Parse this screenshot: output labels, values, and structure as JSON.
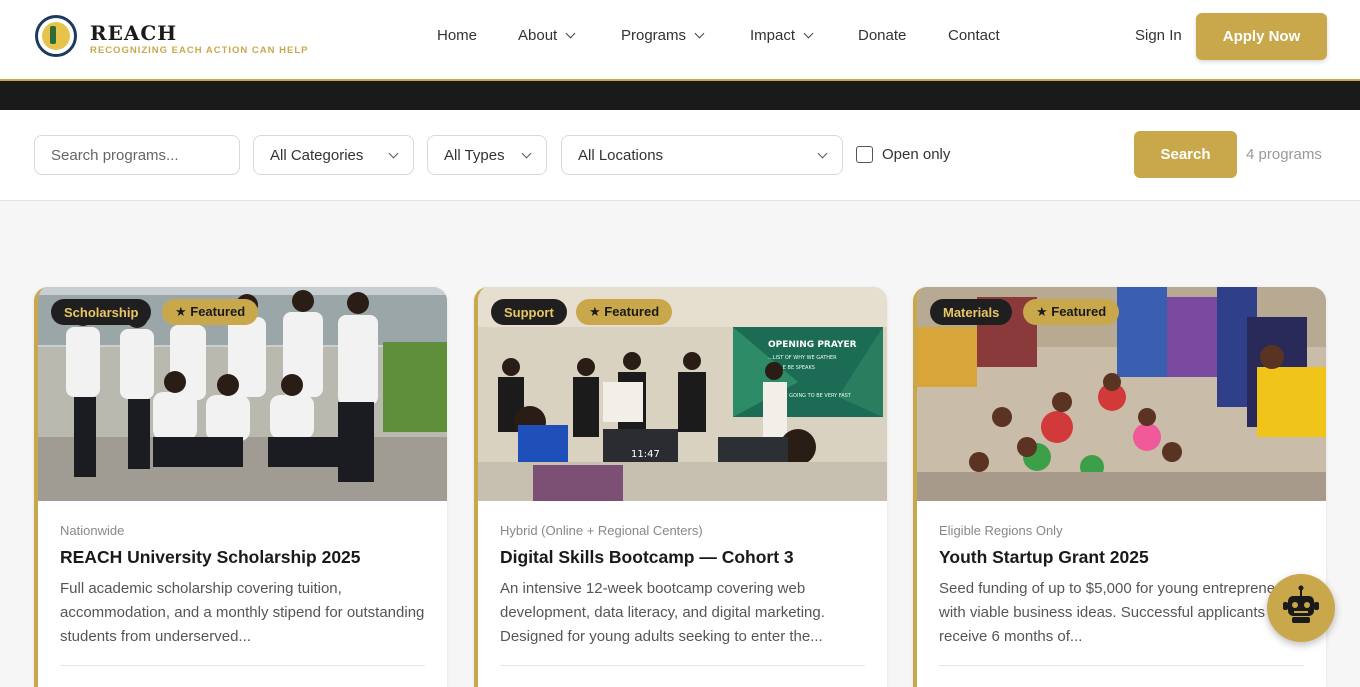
{
  "brand": {
    "name": "REACH",
    "tagline": "RECOGNIZING EACH ACTION CAN HELP"
  },
  "nav": {
    "items": [
      {
        "label": "Home",
        "dropdown": false
      },
      {
        "label": "About",
        "dropdown": true
      },
      {
        "label": "Programs",
        "dropdown": true
      },
      {
        "label": "Impact",
        "dropdown": true
      },
      {
        "label": "Donate",
        "dropdown": false
      },
      {
        "label": "Contact",
        "dropdown": false
      }
    ],
    "sign_in": "Sign In",
    "apply": "Apply Now"
  },
  "filters": {
    "search_placeholder": "Search programs...",
    "category": "All Categories",
    "type": "All Types",
    "location": "All Locations",
    "open_only": "Open only",
    "search_button": "Search",
    "result_count": "4 programs"
  },
  "cards": [
    {
      "category": "Scholarship",
      "featured": "★ Featured",
      "location": "Nationwide",
      "title": "REACH University Scholarship 2025",
      "description": "Full academic scholarship covering tuition, accommodation, and a monthly stipend for outstanding students from underserved..."
    },
    {
      "category": "Support",
      "featured": "★ Featured",
      "location": "Hybrid (Online + Regional Centers)",
      "title": "Digital Skills Bootcamp — Cohort 3",
      "description": "An intensive 12-week bootcamp covering web development, data literacy, and digital marketing. Designed for young adults seeking to enter the...",
      "image_text": {
        "heading": "OPENING PRAYER",
        "lines": [
          "...LIST OF WHY WE GATHER",
          "...E BE SPEAKS"
        ],
        "footer": "...E ARE GOING TO BE VERY FAST",
        "clock": "11:47"
      }
    },
    {
      "category": "Materials",
      "featured": "★ Featured",
      "location": "Eligible Regions Only",
      "title": "Youth Startup Grant 2025",
      "description": "Seed funding of up to $5,000 for young entrepreneurs with viable business ideas. Successful applicants also receive 6 months of..."
    }
  ],
  "colors": {
    "accent": "#c9a84c",
    "dark": "#1a1a1a"
  },
  "chatbot": {
    "icon": "robot-icon"
  }
}
